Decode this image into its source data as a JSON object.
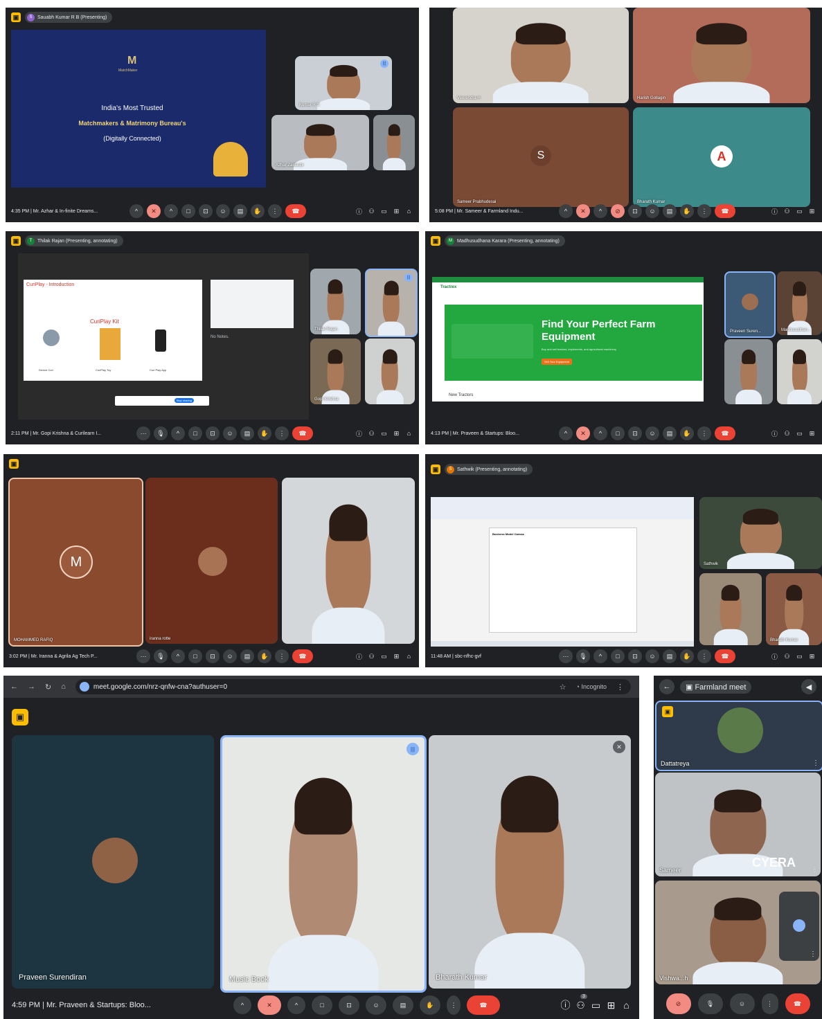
{
  "icons": {
    "camera_off": "camera-off-icon",
    "mic_off": "mic-off-icon",
    "mic": "mic-icon",
    "hand": "hand-icon",
    "end_call": "end-call-icon",
    "info": "info-icon",
    "people": "people-icon",
    "chat": "chat-icon",
    "activities": "activities-icon",
    "lock": "lock-icon",
    "more": "more-icon"
  },
  "colors": {
    "end_call": "#ea4335",
    "camera_off_badge": "#fbbc04",
    "speaking": "#8ab4f8",
    "panel_bg": "#202124"
  },
  "s1": {
    "presenter": "Sauabh Kumar R B (Presenting)",
    "slide_brand": "MatchMaker",
    "slide_line1": "India's Most Trusted",
    "slide_line2": "Matchmakers & Matrimony Bureau's",
    "slide_line3": "(Digitally Connected)",
    "tile_a": "Kumar R S",
    "tile_b": "Azhar Zaidaubi",
    "time": "4:35 PM",
    "meeting": "Mr. Azhar & In-finite Dreams..."
  },
  "s2": {
    "tile_a": "Veerendra H",
    "tile_b": "Harish Gollagin",
    "tile_c": "Sameer Prabhudesai",
    "tile_c_initial": "S",
    "tile_d": "Bharath Kumar",
    "time": "5:08 PM",
    "meeting": "Mr. Sameer & Farmland Indu..."
  },
  "s3": {
    "presenter": "Thilak Rajan (Presenting, annotating)",
    "slide_title": "CuriPlay - Introduction",
    "slide_kit": "CuriPlay Kit",
    "item1": "Device Curi",
    "item2": "CuriPlay Toy",
    "item3": "Curi Play App",
    "notes": "No Notes.",
    "share_btn": "Stop sharing",
    "tile_a": "Thilak Rajan",
    "tile_c": "Gopi Krishna",
    "time": "2:11 PM",
    "meeting": "Mr. Gopi Krishna & Curilearn I..."
  },
  "s4": {
    "presenter": "Madhusudhana Karara (Presenting, annotating)",
    "site_brand": "Tractrex",
    "headline1": "Find Your Perfect Farm",
    "headline2": "Equipment",
    "subline": "Buy and sell tractors, implements, and agricultural machinery",
    "cta": "Sell Your Equipment",
    "section": "New Tractors",
    "tile_a": "Praveen Suren...",
    "tile_b": "Madhusudhan...",
    "time": "4:13 PM",
    "meeting": "Mr. Praveen & Startups: Bloo..."
  },
  "s5": {
    "tile_a": "MOHAMMED RAFIQ",
    "tile_a_initial": "M",
    "tile_b": "iranna rotte",
    "time": "3:02 PM",
    "meeting": "Mr. Iranna & Agrila Ag Tech P..."
  },
  "s6": {
    "presenter": "Sathwik (Presenting, annotating)",
    "doc_title": "Business Model Canvas",
    "tile_a": "Sathwik",
    "tile_c": "Bharath Kumar",
    "time": "11:48 AM",
    "meeting": "sbc-nfhc-gvf"
  },
  "s7": {
    "url": "meet.google.com/nrz-qnfw-cna?authuser=0",
    "incognito": "Incognito",
    "tile_a": "Praveen Surendiran",
    "tile_b": "Music Book",
    "tile_c": "Bharath Kumar",
    "time": "4:59 PM",
    "meeting": "Mr. Praveen & Startups: Bloo...",
    "people_count": "3"
  },
  "s8": {
    "title": "Farmland meet",
    "tile_a": "Dattatreya",
    "tile_b": "Sameer",
    "tile_b_shirt": "CYERA",
    "tile_c": "Vishwa...h"
  }
}
